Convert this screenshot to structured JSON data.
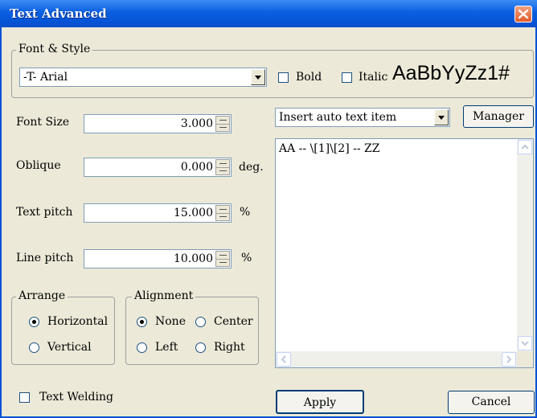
{
  "window": {
    "title": "Text Advanced"
  },
  "font_style": {
    "legend": "Font & Style",
    "font_value": "-T-  Arial",
    "bold_label": "Bold",
    "italic_label": "Italic",
    "sample": "AaBbYyZz1#"
  },
  "fields": {
    "font_size": {
      "label": "Font Size",
      "value": "3.000"
    },
    "oblique": {
      "label": "Oblique",
      "value": "0.000",
      "unit": "deg."
    },
    "text_pitch": {
      "label": "Text pitch",
      "value": "15.000",
      "unit": "%"
    },
    "line_pitch": {
      "label": "Line pitch",
      "value": "10.000",
      "unit": "%"
    }
  },
  "arrange": {
    "legend": "Arrange",
    "horizontal": "Horizontal",
    "vertical": "Vertical",
    "selected": "Horizontal"
  },
  "alignment": {
    "legend": "Alignment",
    "none": "None",
    "center": "Center",
    "left": "Left",
    "right": "Right",
    "selected": "None"
  },
  "auto_text": {
    "value": "Insert auto text item",
    "manager_label": "Manager"
  },
  "text_content": "AA -- \\[1]\\[2] -- ZZ",
  "text_welding": {
    "label": "Text Welding"
  },
  "buttons": {
    "apply": "Apply",
    "cancel": "Cancel"
  },
  "colors": {
    "title_bar": "#0553d6",
    "dialog_bg": "#ece9d8",
    "close_button": "#e25b28"
  }
}
